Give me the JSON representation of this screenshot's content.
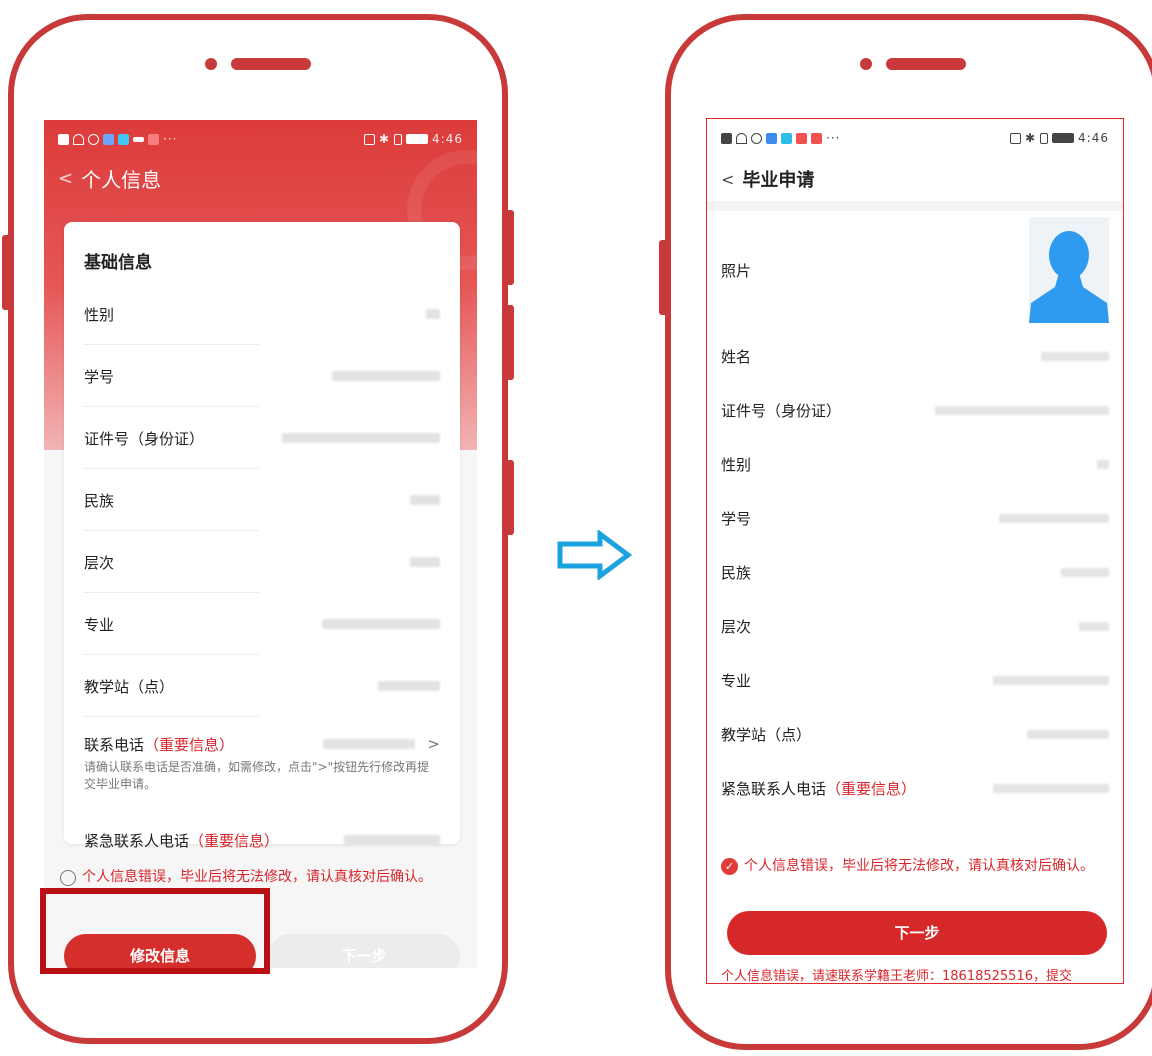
{
  "left_screen": {
    "status_time": "4:46",
    "status_left_dots": "···",
    "nav_back": "<",
    "nav_title": "个人信息",
    "card_title": "基础信息",
    "rows": [
      {
        "label": "性别"
      },
      {
        "label": "学号"
      },
      {
        "label": "证件号（身份证）"
      },
      {
        "label": "民族"
      },
      {
        "label": "层次"
      },
      {
        "label": "专业"
      },
      {
        "label": "教学站（点）"
      }
    ],
    "phone_row": {
      "label": "联系电话",
      "label_important": "（重要信息）",
      "chevron": ">",
      "hint": "请确认联系电话是否准确，如需修改，点击\">\"按钮先行修改再提交毕业申请。"
    },
    "emergency_row": {
      "label": "紧急联系人电话",
      "label_important": "（重要信息）"
    },
    "consent_text": "个人信息错误，毕业后将无法修改，请认真核对后确认。",
    "btn_edit": "修改信息",
    "btn_next": "下一步"
  },
  "right_screen": {
    "status_time": "4:46",
    "status_left_dots": "···",
    "nav_back": "<",
    "nav_title": "毕业申请",
    "photo_label": "照片",
    "rows": [
      {
        "label": "姓名"
      },
      {
        "label": "证件号（身份证）"
      },
      {
        "label": "性别"
      },
      {
        "label": "学号"
      },
      {
        "label": "民族"
      },
      {
        "label": "层次"
      },
      {
        "label": "专业"
      },
      {
        "label": "教学站（点）"
      }
    ],
    "emergency_row": {
      "label": "紧急联系人电话",
      "label_important": "（重要信息）"
    },
    "consent_check": "✓",
    "consent_text": "个人信息错误，毕业后将无法修改，请认真核对后确认。",
    "btn_next": "下一步",
    "contact_text": "个人信息错误，请速联系学籍王老师：18618525516，提交"
  },
  "colors": {
    "frame": "#c8393a",
    "accent": "#d62d2d",
    "highlight": "#b90f15",
    "arrow": "#1aa3e0"
  },
  "icons": {
    "transition_arrow": "right-double-arrow-icon",
    "avatar": "person-avatar-icon"
  }
}
